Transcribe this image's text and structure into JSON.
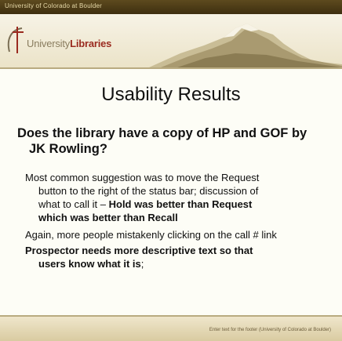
{
  "header": {
    "institution": "University of Colorado at Boulder",
    "logo_prefix": "University",
    "logo_suffix": "Libraries"
  },
  "slide": {
    "title": "Usability Results",
    "question_line1": "Does the library have a copy of HP and GOF by",
    "question_line2": "JK Rowling?",
    "point1_line1": "Most common suggestion was to move the Request",
    "point1_line2": "button to the right of the status bar; discussion of",
    "point1_line3": "what to call it – ",
    "point1_line3_bold": "Hold was better than Request",
    "point1_line4_bold": "which was better than Recall",
    "point2": "Again, more people mistakenly clicking on the call # link",
    "point3_bold_line1": "Prospector needs more descriptive text so that",
    "point3_bold_line2": "users know what it is",
    "point3_tail": ";"
  },
  "footer": {
    "text": "Enter text for the footer (University of Colorado at Boulder)"
  },
  "colors": {
    "header_bar": "#4a3a16",
    "banner_bg": "#f1ebd6",
    "accent_red": "#9a2a1f",
    "text": "#111111"
  }
}
